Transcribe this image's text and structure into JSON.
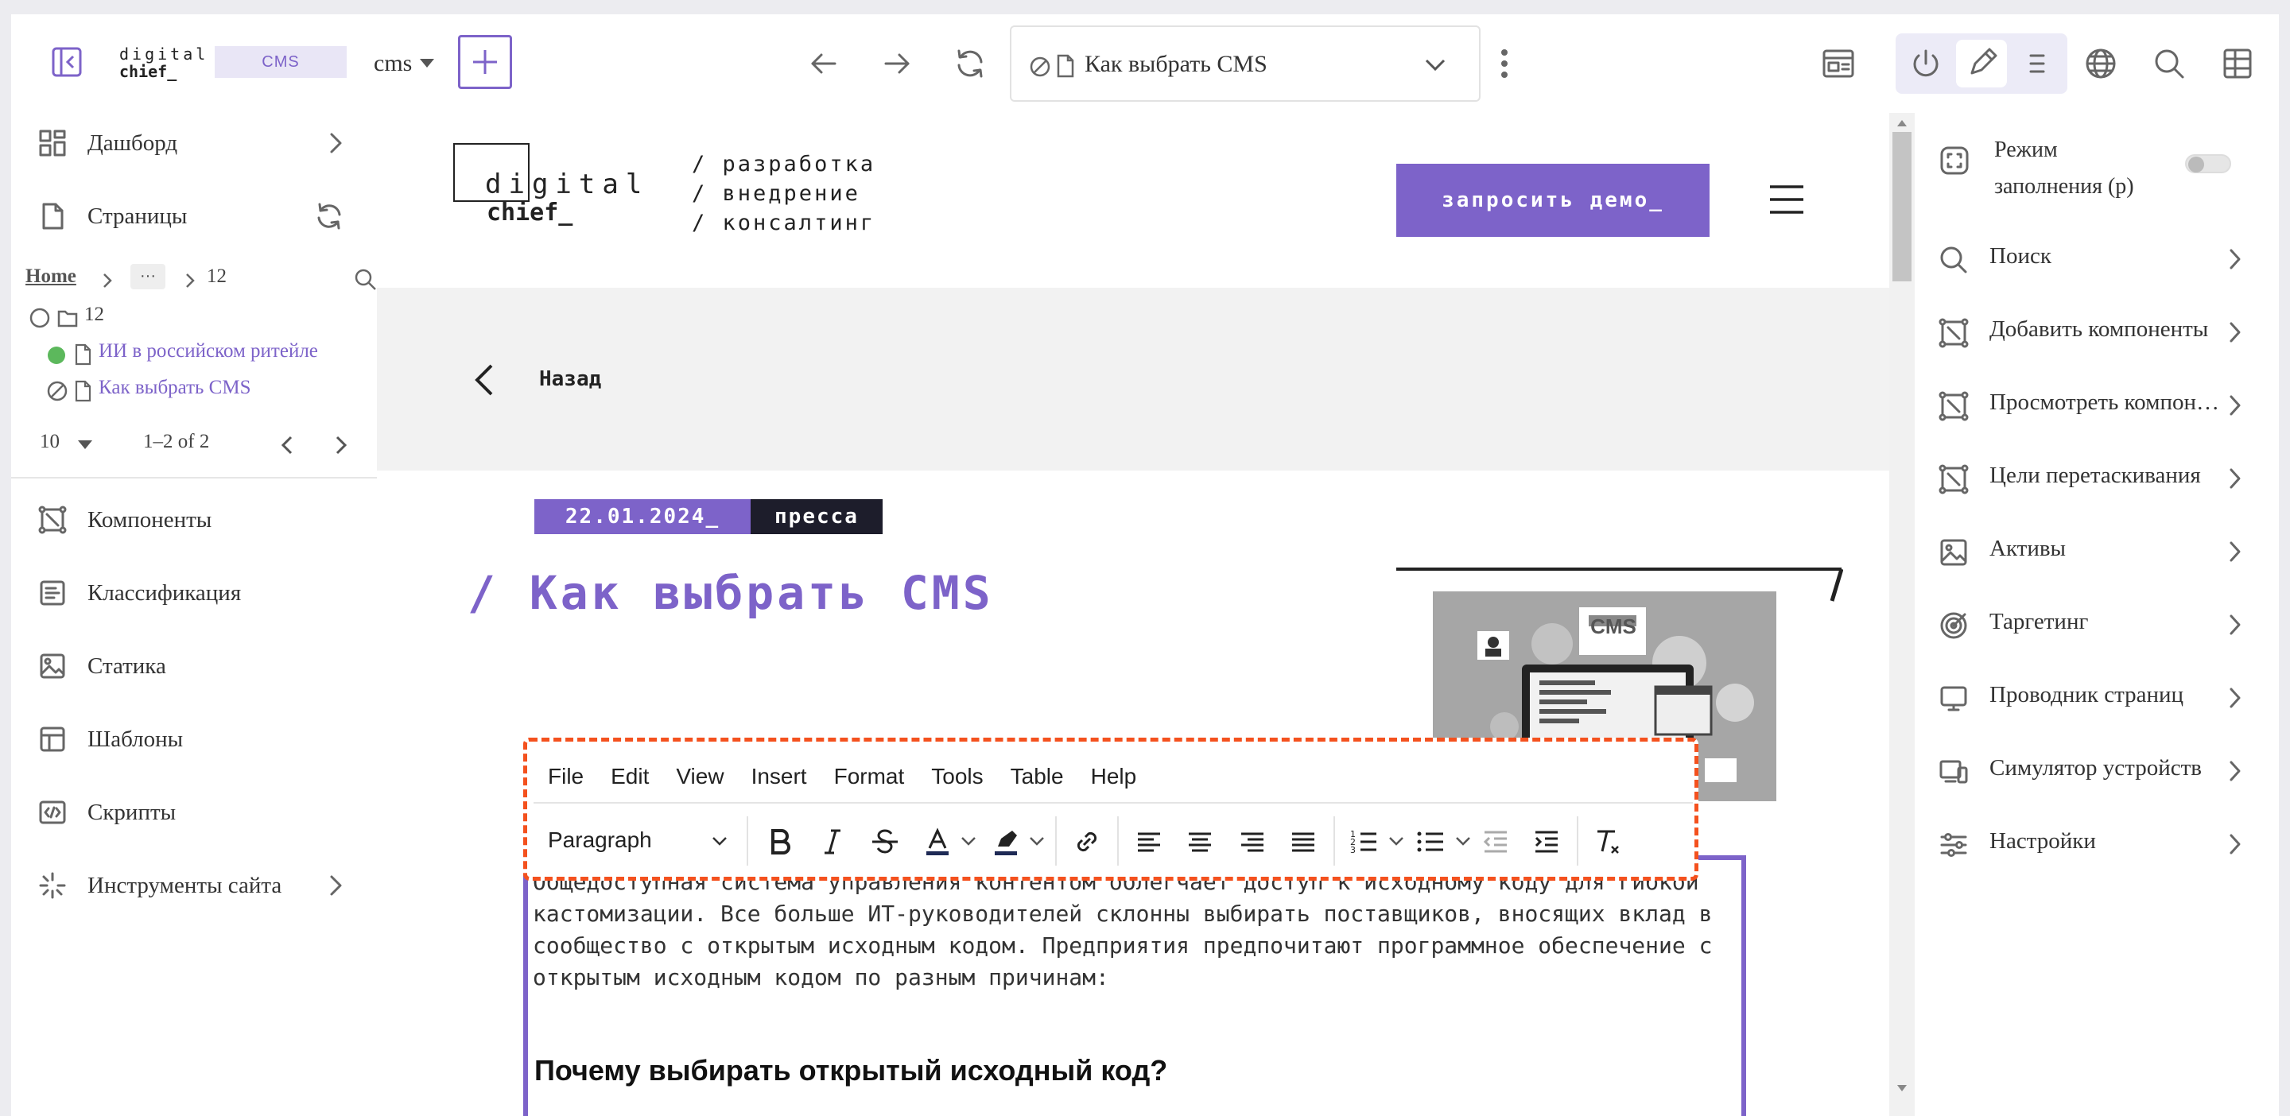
{
  "topbar": {
    "logo_top": "digital",
    "logo_bottom": "chief_",
    "cms_badge": "CMS",
    "site_select": "cms",
    "url_title": "Как выбрать CMS"
  },
  "sidebar": {
    "dashboard": "Дашборд",
    "pages": "Страницы",
    "breadcrumb": {
      "home": "Home",
      "ellipsis": "···",
      "current": "12"
    },
    "tree": [
      {
        "label": "12"
      },
      {
        "label": "ИИ в российском ритейле",
        "status": "published"
      },
      {
        "label": "Как выбрать CMS",
        "status": "draft"
      }
    ],
    "pagination": {
      "page_size": "10",
      "range": "1–2 of 2"
    },
    "sections": [
      "Компоненты",
      "Классификация",
      "Статика",
      "Шаблоны",
      "Скрипты",
      "Инструменты сайта"
    ]
  },
  "right_panel": {
    "fill_mode_label": "Режим заполнения (p)",
    "items": [
      "Поиск",
      "Добавить компоненты",
      "Просмотреть компоненты",
      "Цели перетаскивания",
      "Активы",
      "Таргетинг",
      "Проводник страниц",
      "Симулятор устройств",
      "Настройки"
    ]
  },
  "site": {
    "logo_top": "digital",
    "logo_bottom": "chief_",
    "nav_development": "разработка",
    "nav_implementation": "внедрение",
    "nav_consulting": "консалтинг",
    "nav_prefix": "/",
    "demo_button": "запросить демо_",
    "back_link": "Назад",
    "date_tag": "22.01.2024_",
    "category_tag": "пресса",
    "title": "/ Как выбрать CMS",
    "hero_badge": "CMS",
    "body_text": "Общедоступная система управления контентом облегчает доступ к исходному коду для гибкой кастомизации. Все больше ИТ-руководителей склонны выбирать поставщиков, вносящих вклад в сообщество с открытым исходным кодом. Предприятия предпочитают программное обеспечение с открытым исходным кодом по разным причинам:",
    "subheading": "Почему выбирать открытый исходный код?"
  },
  "editor": {
    "menu": [
      "File",
      "Edit",
      "View",
      "Insert",
      "Format",
      "Tools",
      "Table",
      "Help"
    ],
    "block_format": "Paragraph"
  },
  "colors": {
    "accent": "#7d63c9",
    "editor_outline": "#f4511e",
    "status_published": "#5cb85c"
  }
}
